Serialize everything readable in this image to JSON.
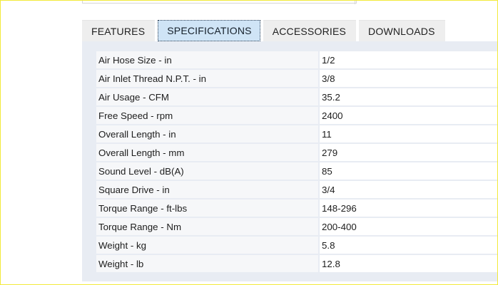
{
  "tabs": [
    {
      "label": "FEATURES",
      "active": false
    },
    {
      "label": "SPECIFICATIONS",
      "active": true
    },
    {
      "label": "ACCESSORIES",
      "active": false
    },
    {
      "label": "DOWNLOADS",
      "active": false
    }
  ],
  "specs": [
    {
      "label": "Air Hose Size - in",
      "value": "1/2"
    },
    {
      "label": "Air Inlet Thread N.P.T. - in",
      "value": "3/8"
    },
    {
      "label": "Air Usage - CFM",
      "value": "35.2"
    },
    {
      "label": "Free Speed - rpm",
      "value": "2400"
    },
    {
      "label": "Overall Length - in",
      "value": "11"
    },
    {
      "label": "Overall Length - mm",
      "value": "279"
    },
    {
      "label": "Sound Level - dB(A)",
      "value": "85"
    },
    {
      "label": "Square Drive - in",
      "value": "3/4"
    },
    {
      "label": "Torque Range - ft-lbs",
      "value": "148-296"
    },
    {
      "label": "Torque Range - Nm",
      "value": "200-400"
    },
    {
      "label": "Weight - kg",
      "value": "5.8"
    },
    {
      "label": "Weight - lb",
      "value": "12.8"
    }
  ],
  "colors": {
    "active_tab_bg": "#cfe4f6",
    "tab_bg": "#eeeeee",
    "panel_bg": "#e8ecf3",
    "frame_border": "#f2ea3a"
  }
}
